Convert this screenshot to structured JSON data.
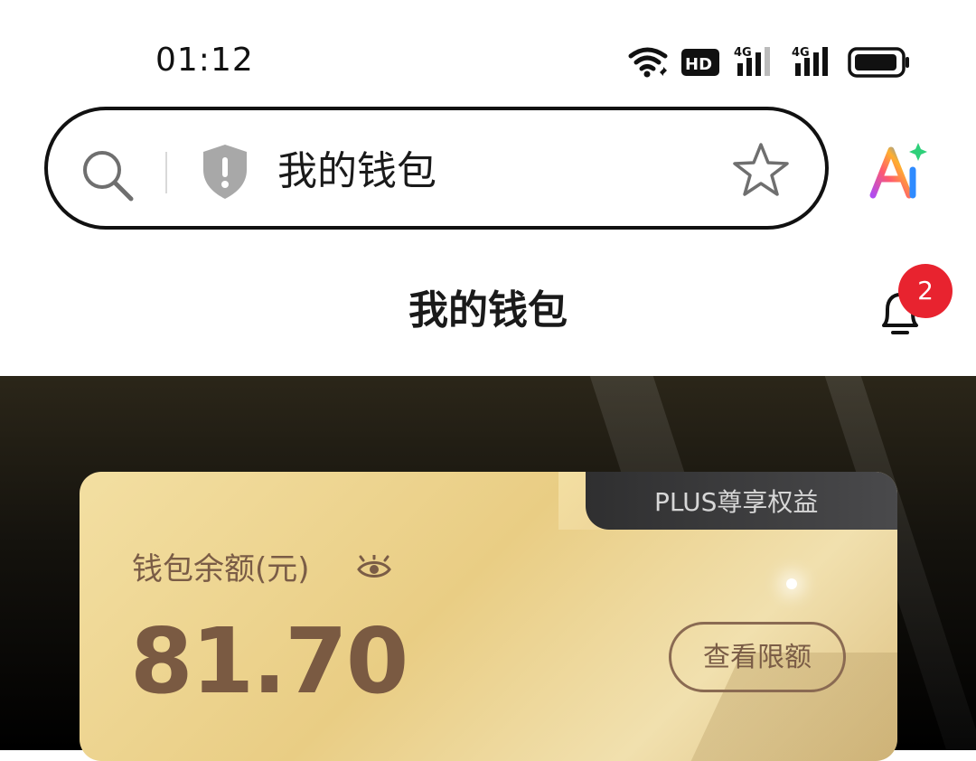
{
  "status_bar": {
    "time": "01:12",
    "icons": [
      "wifi-icon",
      "hd-icon",
      "signal-4g-icon",
      "signal-4g-icon",
      "battery-icon"
    ]
  },
  "browser": {
    "url_text": "我的钱包",
    "icons": [
      "search-icon",
      "shield-warning-icon",
      "star-icon",
      "ai-assistant-icon"
    ]
  },
  "page": {
    "title": "我的钱包",
    "notification_count": "2"
  },
  "wallet_card": {
    "tab_label": "PLUS尊享权益",
    "balance_label": "钱包余额(元)",
    "balance_value": "81.70",
    "limit_button": "查看限额"
  },
  "colors": {
    "badge": "#e8232f",
    "card_gold": "#e9cd84",
    "card_text": "#7a5c46",
    "banner_dark": "#14120d"
  }
}
